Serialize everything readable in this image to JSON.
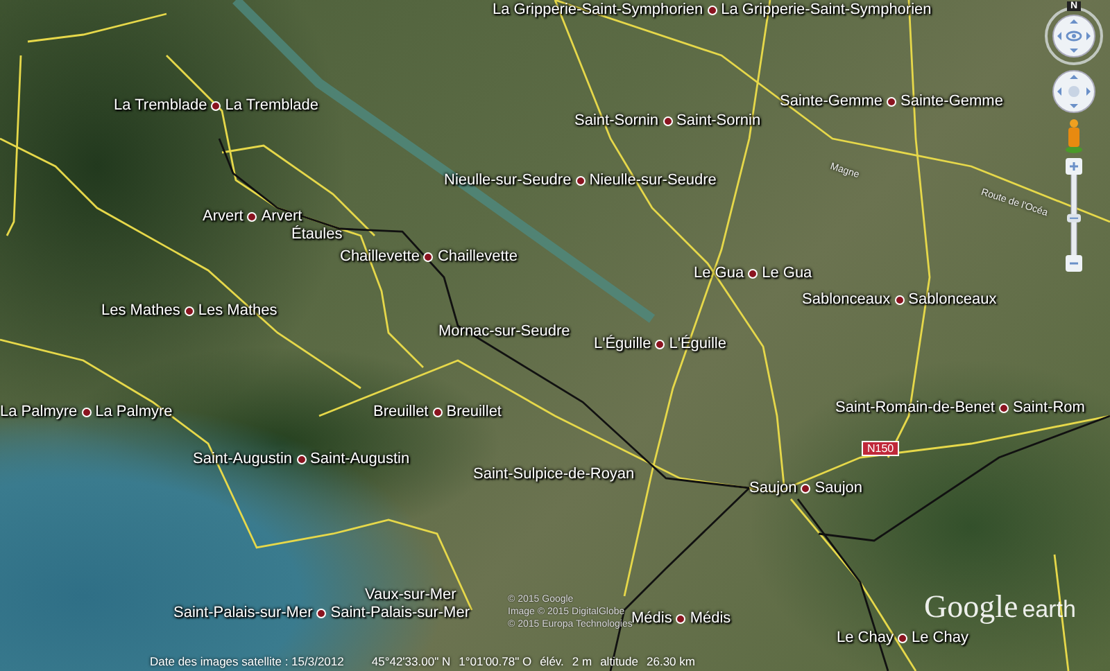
{
  "map_labels": [
    {
      "texts": [
        "La Gripperie-Saint-Symphorien",
        "La Gripperie-Saint-Symphorien"
      ]
    },
    {
      "texts": [
        "La Tremblade",
        "La Tremblade"
      ]
    },
    {
      "texts": [
        "Sainte-Gemme",
        "Sainte-Gemme"
      ]
    },
    {
      "texts": [
        "Saint-Sornin",
        "Saint-Sornin"
      ]
    },
    {
      "texts": [
        "Nieulle-sur-Seudre",
        "Nieulle-sur-Seudre"
      ]
    },
    {
      "texts": [
        "Arvert",
        "Arvert"
      ]
    },
    {
      "texts": [
        "Étaules"
      ]
    },
    {
      "texts": [
        "Chaillevette",
        "Chaillevette"
      ]
    },
    {
      "texts": [
        "Le Gua",
        "Le Gua"
      ]
    },
    {
      "texts": [
        "Sablonceaux",
        "Sablonceaux"
      ]
    },
    {
      "texts": [
        "Les Mathes",
        "Les Mathes"
      ]
    },
    {
      "texts": [
        "Mornac-sur-Seudre"
      ]
    },
    {
      "texts": [
        "L'Éguille",
        "L'Éguille"
      ]
    },
    {
      "texts": [
        "La Palmyre",
        "La Palmyre"
      ]
    },
    {
      "texts": [
        "Breuillet",
        "Breuillet"
      ]
    },
    {
      "texts": [
        "Saint-Romain-de-Benet",
        "Saint-Rom"
      ]
    },
    {
      "texts": [
        "Saint-Augustin",
        "Saint-Augustin"
      ]
    },
    {
      "texts": [
        "Saint-Sulpice-de-Royan"
      ]
    },
    {
      "texts": [
        "Saujon",
        "Saujon"
      ]
    },
    {
      "texts": [
        "Vaux-sur-Mer"
      ]
    },
    {
      "texts": [
        "Saint-Palais-sur-Mer",
        "Saint-Palais-sur-Mer"
      ]
    },
    {
      "texts": [
        "Médis",
        "Médis"
      ]
    },
    {
      "texts": [
        "Le Chay",
        "Le Chay"
      ]
    }
  ],
  "road_labels": [
    "Magne",
    "Route de l'Océa"
  ],
  "road_shield": "N150",
  "copyright": [
    "© 2015 Google",
    "Image © 2015 DigitalGlobe",
    "© 2015 Europa Technologies"
  ],
  "logo": {
    "word1": "Google",
    "word2": "earth"
  },
  "compass_letter": "N",
  "zoom_slider": {
    "level": 0.45
  },
  "status_bar": {
    "imagery_date": "Date des images satellite : 15/3/2012",
    "latitude": "45°42'33.00\" N",
    "longitude": "1°01'00.78\" O",
    "elevation_label": "élév.",
    "elevation": "2 m",
    "altitude_label": "altitude",
    "altitude": "26.30 km"
  }
}
